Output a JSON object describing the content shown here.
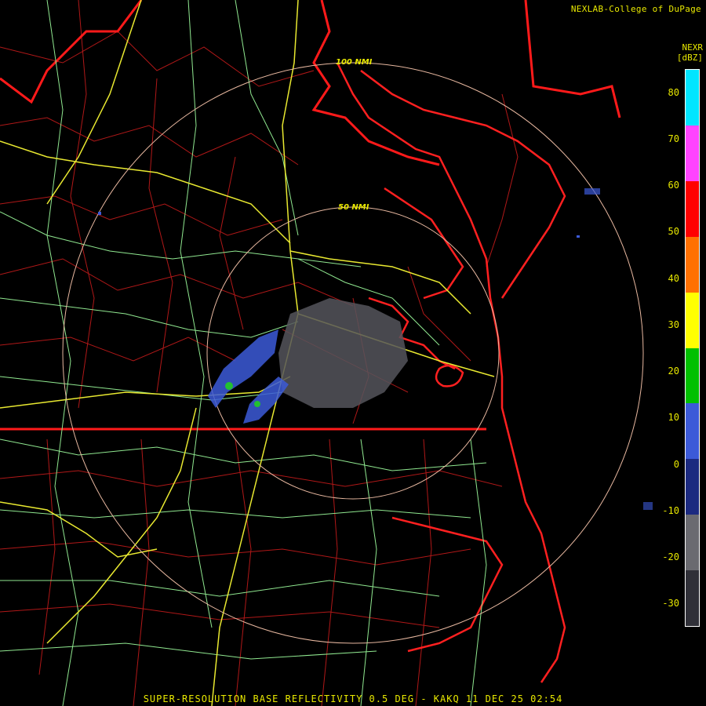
{
  "header": {
    "credit": "NEXLAB-College of DuPage"
  },
  "legend": {
    "product": "NEXR",
    "units": "[dBZ]",
    "ticks": [
      "80",
      "70",
      "60",
      "50",
      "40",
      "30",
      "20",
      "10",
      "0",
      "-10",
      "-20",
      "-30"
    ],
    "tick_values": [
      80,
      70,
      60,
      50,
      40,
      30,
      20,
      10,
      0,
      -10,
      -20,
      -30
    ],
    "range": [
      -35,
      85
    ],
    "colors": [
      "#00e5ff",
      "#ff44ff",
      "#ff0000",
      "#ff7000",
      "#ffff00",
      "#00c000",
      "#3c5ad8",
      "#1c2a80",
      "#6a6a70",
      "#303038"
    ]
  },
  "range_rings": [
    {
      "label": "50 NMI",
      "nmi": 50
    },
    {
      "label": "100 NMI",
      "nmi": 100
    }
  ],
  "footer": {
    "title": "SUPER-RESOLUTION BASE REFLECTIVITY 0.5 DEG - KAKQ 11 DEC 25 02:54"
  },
  "map": {
    "colors": {
      "state": "#ff1a1a",
      "county": "#c01818",
      "highway": "#e8e830",
      "road": "#90e890",
      "ring": "#e8b8a0"
    }
  }
}
